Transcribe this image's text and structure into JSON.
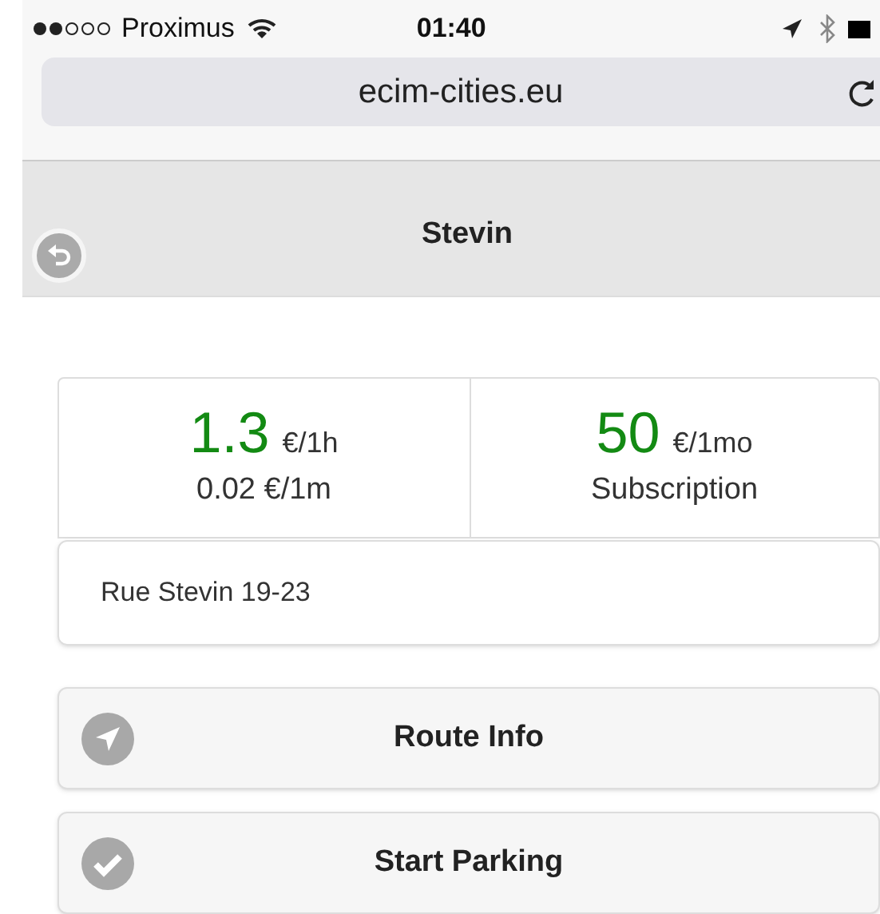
{
  "status_bar": {
    "carrier": "Proximus",
    "time": "01:40"
  },
  "address_bar": {
    "url": "ecim-cities.eu"
  },
  "header": {
    "title": "Stevin"
  },
  "prices": [
    {
      "amount": "1.3",
      "unit": "€/1h",
      "detail": "0.02 €/1m"
    },
    {
      "amount": "50",
      "unit": "€/1mo",
      "detail": "Subscription"
    }
  ],
  "address": "Rue Stevin 19-23",
  "actions": [
    {
      "kind": "route",
      "label": "Route Info"
    },
    {
      "kind": "start",
      "label": "Start Parking"
    }
  ]
}
